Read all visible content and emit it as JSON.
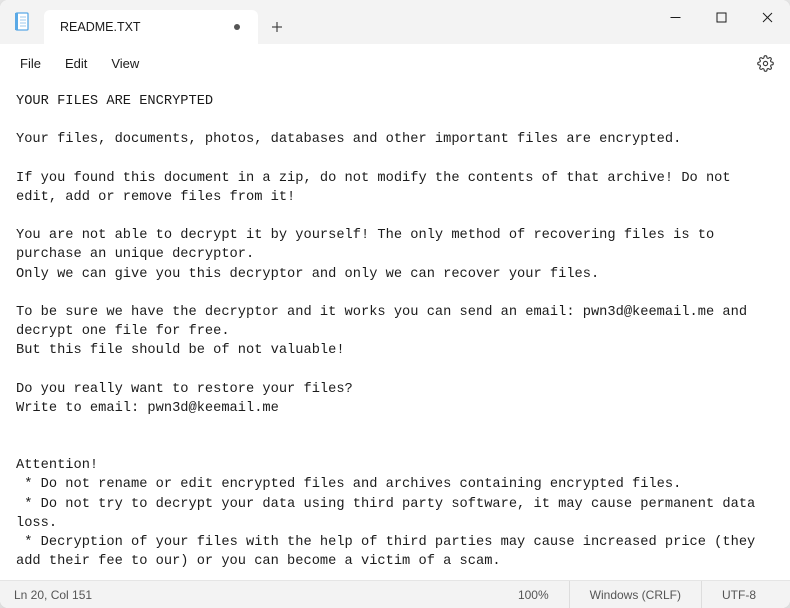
{
  "titlebar": {
    "tab_title": "README.TXT",
    "tab_modified": true
  },
  "menubar": {
    "file": "File",
    "edit": "Edit",
    "view": "View"
  },
  "editor": {
    "content": "YOUR FILES ARE ENCRYPTED\n\nYour files, documents, photos, databases and other important files are encrypted.\n\nIf you found this document in a zip, do not modify the contents of that archive! Do not edit, add or remove files from it!\n\nYou are not able to decrypt it by yourself! The only method of recovering files is to purchase an unique decryptor.\nOnly we can give you this decryptor and only we can recover your files.\n\nTo be sure we have the decryptor and it works you can send an email: pwn3d@keemail.me and decrypt one file for free.\nBut this file should be of not valuable!\n\nDo you really want to restore your files?\nWrite to email: pwn3d@keemail.me\n\n\nAttention!\n * Do not rename or edit encrypted files and archives containing encrypted files.\n * Do not try to decrypt your data using third party software, it may cause permanent data loss.\n * Decryption of your files with the help of third parties may cause increased price (they add their fee to our) or you can become a victim of a scam."
  },
  "statusbar": {
    "position": "Ln 20, Col 151",
    "zoom": "100%",
    "line_ending": "Windows (CRLF)",
    "encoding": "UTF-8"
  }
}
